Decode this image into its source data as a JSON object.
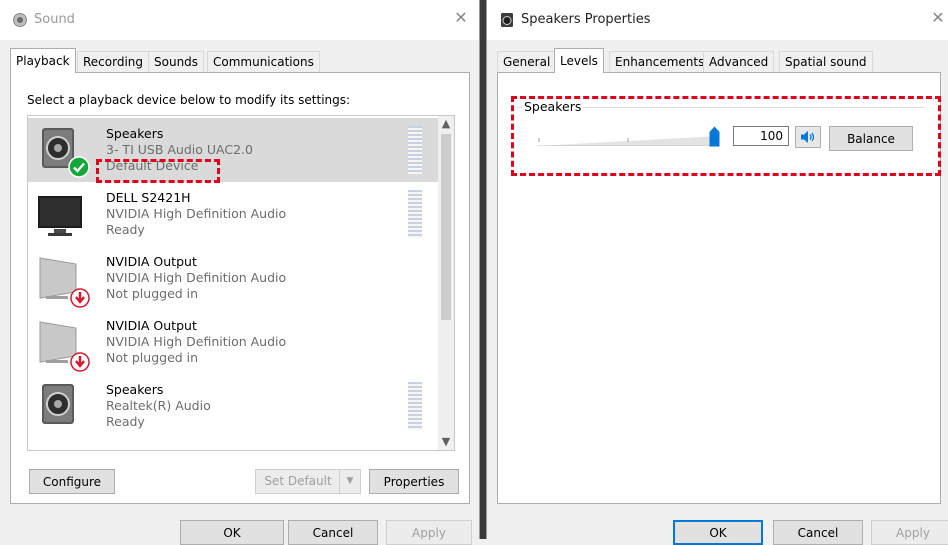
{
  "sound_window": {
    "title": "Sound",
    "tabs": [
      {
        "label": "Playback",
        "active": true
      },
      {
        "label": "Recording",
        "active": false
      },
      {
        "label": "Sounds",
        "active": false
      },
      {
        "label": "Communications",
        "active": false
      }
    ],
    "instruction": "Select a playback device below to modify its settings:",
    "devices": [
      {
        "name": "Speakers",
        "driver": "3- TI USB Audio UAC2.0",
        "status": "Default Device",
        "icon": "speaker-icon",
        "badge": "default-check-badge",
        "selected": true
      },
      {
        "name": "DELL S2421H",
        "driver": "NVIDIA High Definition Audio",
        "status": "Ready",
        "icon": "monitor-icon",
        "badge": "",
        "selected": false
      },
      {
        "name": "NVIDIA Output",
        "driver": "NVIDIA High Definition Audio",
        "status": "Not plugged in",
        "icon": "monitor-icon",
        "badge": "unplugged-badge",
        "selected": false
      },
      {
        "name": "NVIDIA Output",
        "driver": "NVIDIA High Definition Audio",
        "status": "Not plugged in",
        "icon": "monitor-icon",
        "badge": "unplugged-badge",
        "selected": false
      },
      {
        "name": "Speakers",
        "driver": "Realtek(R) Audio",
        "status": "Ready",
        "icon": "speaker-icon",
        "badge": "",
        "selected": false
      }
    ],
    "buttons": {
      "configure": "Configure",
      "set_default": "Set Default",
      "properties": "Properties",
      "ok": "OK",
      "cancel": "Cancel",
      "apply": "Apply"
    }
  },
  "properties_window": {
    "title": "Speakers Properties",
    "tabs": [
      {
        "label": "General",
        "active": false
      },
      {
        "label": "Levels",
        "active": true
      },
      {
        "label": "Enhancements",
        "active": false
      },
      {
        "label": "Advanced",
        "active": false
      },
      {
        "label": "Spatial sound",
        "active": false
      }
    ],
    "levels": {
      "group_label": "Speakers",
      "volume_value": "100",
      "volume_level": 1.0,
      "balance_label": "Balance"
    },
    "buttons": {
      "ok": "OK",
      "cancel": "Cancel",
      "apply": "Apply"
    }
  },
  "colors": {
    "highlight_box": "#e0001b",
    "accent": "#0078d7",
    "check_green": "#12a83a",
    "unplug_red": "#d9182b"
  }
}
